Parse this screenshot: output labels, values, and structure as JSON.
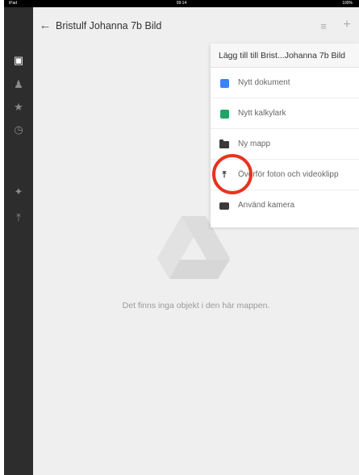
{
  "status_bar": {
    "carrier": "iPad",
    "clock": "09:14",
    "battery": "100%"
  },
  "sidebar": {
    "items": [
      {
        "icon": "folder-icon",
        "active": true
      },
      {
        "icon": "shared-people-icon",
        "active": false
      },
      {
        "icon": "star-icon",
        "active": false
      },
      {
        "icon": "recent-clock-icon",
        "active": false
      },
      {
        "icon": "pin-icon",
        "active": false
      },
      {
        "icon": "upload-icon",
        "active": false
      }
    ]
  },
  "header": {
    "back_icon": "back-arrow-icon",
    "title": "Bristulf Johanna 7b Bild",
    "list_icon": "list-view-icon",
    "add_icon": "plus-icon"
  },
  "empty_state": {
    "logo": "google-drive-logo",
    "message": "Det finns inga objekt i den här mappen."
  },
  "menu": {
    "title": "Lägg till till Brist...Johanna 7b Bild",
    "items": [
      {
        "label": "Nytt dokument",
        "icon": "docs-icon"
      },
      {
        "label": "Nytt kalkylark",
        "icon": "sheets-icon"
      },
      {
        "label": "Ny mapp",
        "icon": "folder-icon"
      },
      {
        "label": "Överför foton och videoklipp",
        "icon": "upload-icon"
      },
      {
        "label": "Använd kamera",
        "icon": "camera-icon"
      }
    ]
  },
  "colors": {
    "sidebar_bg": "#2d2d2d",
    "content_bg": "#efefef",
    "annotation_circle": "#e8321f",
    "docs_blue": "#3b82f6",
    "sheets_green": "#20a464"
  }
}
